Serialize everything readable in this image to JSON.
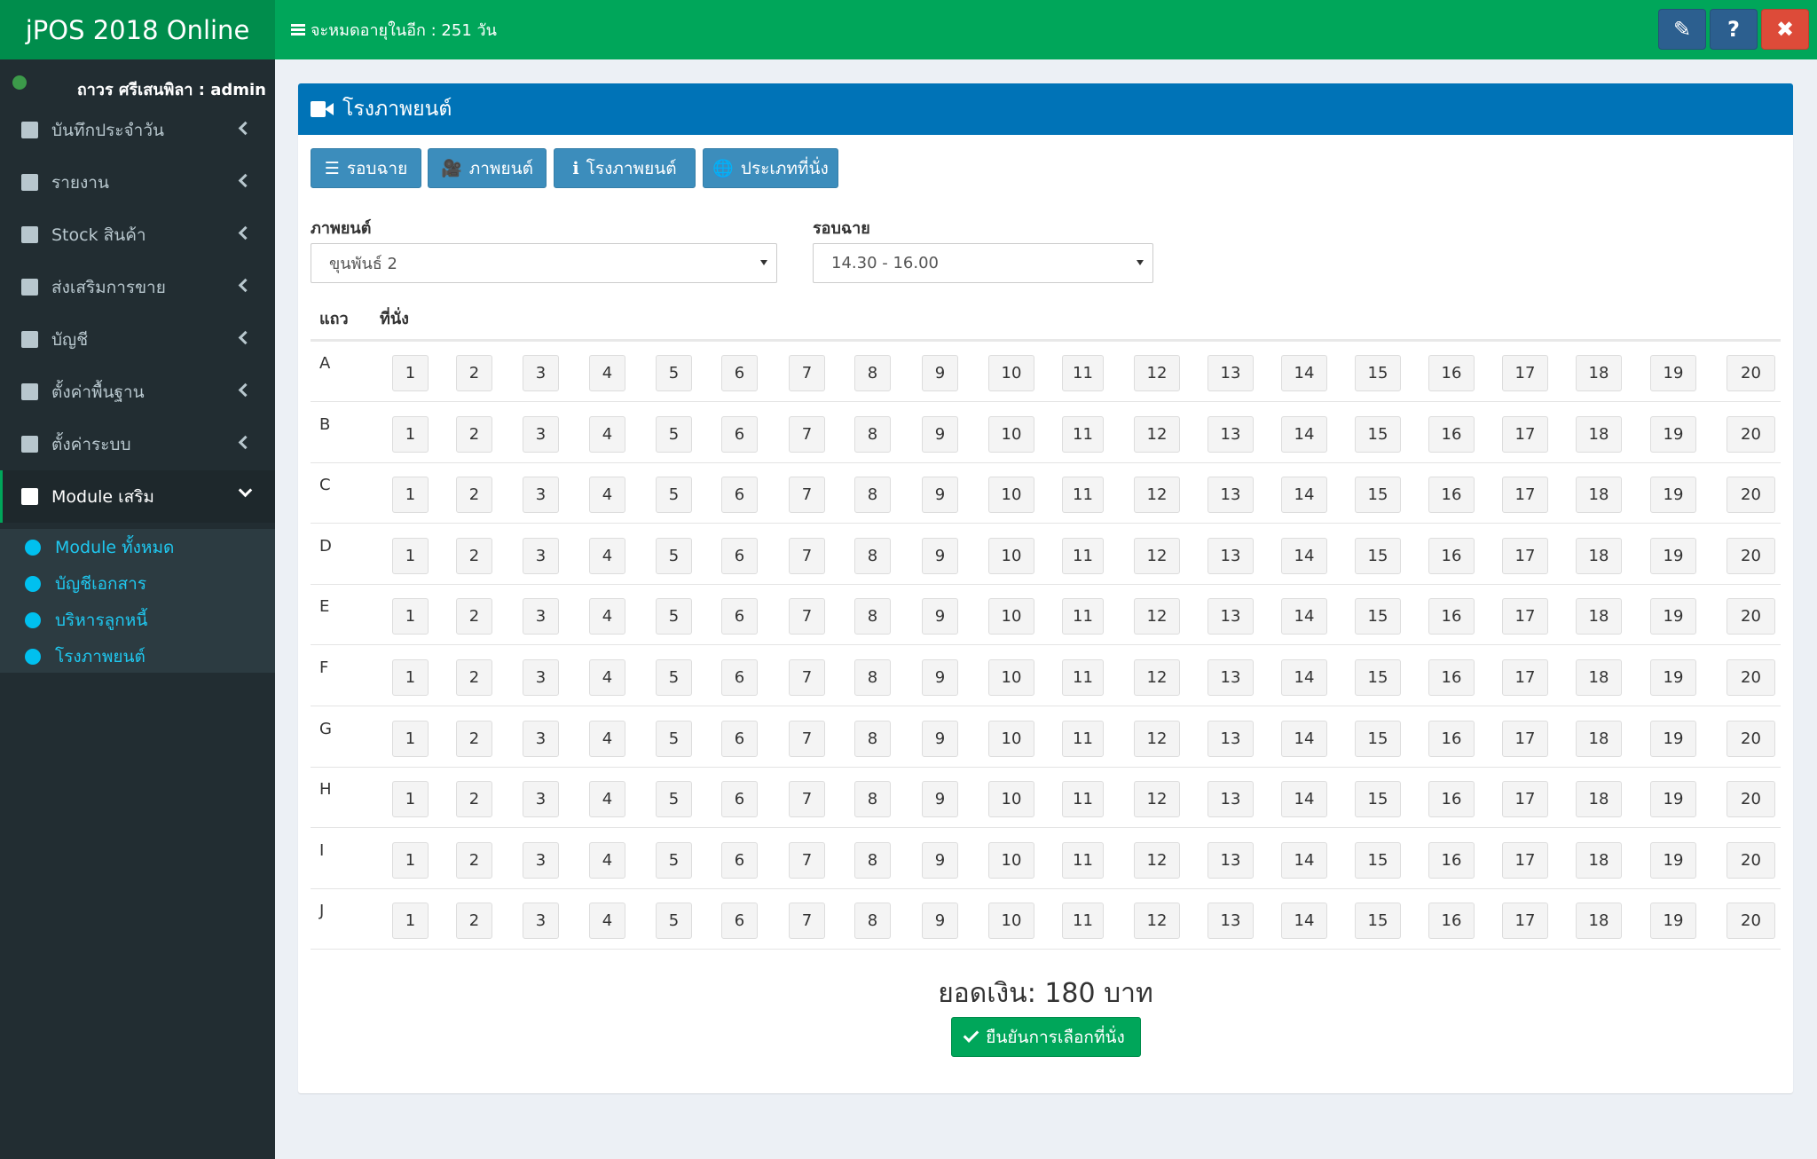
{
  "app": {
    "title": "jPOS 2018 Online",
    "expiry_text": "จะหมดอายุในอีก : 251 วัน"
  },
  "topbar": {
    "edit_label": "✎",
    "help_label": "?",
    "close_label": "✖"
  },
  "user": {
    "name": "ถาวร ศรีเสนพิลา : admin",
    "status_color": "#3c9a4a"
  },
  "sidebar": {
    "items": [
      {
        "label": "บันทึกประจำวัน",
        "icon": "book-icon"
      },
      {
        "label": "รายงาน",
        "icon": "file-icon"
      },
      {
        "label": "Stock สินค้า",
        "icon": "grid-icon"
      },
      {
        "label": "ส่งเสริมการขาย",
        "icon": "gift-icon"
      },
      {
        "label": "บัญชี",
        "icon": "laptop-icon"
      },
      {
        "label": "ตั้งค่าพื้นฐาน",
        "icon": "gear-icon"
      },
      {
        "label": "ตั้งค่าระบบ",
        "icon": "gears-icon"
      },
      {
        "label": "Module เสริม",
        "icon": "plug-icon"
      }
    ],
    "submenu": [
      {
        "label": "Module ทั้งหมด"
      },
      {
        "label": "บัญชีเอกสาร"
      },
      {
        "label": "บริหารลูกหนี้"
      },
      {
        "label": "โรงภาพยนต์"
      }
    ]
  },
  "box": {
    "title": "โรงภาพยนต์"
  },
  "tabs": [
    {
      "label": "รอบฉาย",
      "icon": "☰"
    },
    {
      "label": "ภาพยนต์",
      "icon": "🎥"
    },
    {
      "label": "โรงภาพยนต์",
      "icon": "ℹ"
    },
    {
      "label": "ประเภทที่นั่ง",
      "icon": "🌐"
    }
  ],
  "form": {
    "movie_label": "ภาพยนต์",
    "movie_value": "ขุนพันธ์ 2",
    "showtime_label": "รอบฉาย",
    "showtime_value": "14.30 - 16.00"
  },
  "table": {
    "row_header": "แถว",
    "seat_header": "ที่นั่ง",
    "rows": [
      "A",
      "B",
      "C",
      "D",
      "E",
      "F",
      "G",
      "H",
      "I",
      "J"
    ],
    "seats": [
      "1",
      "2",
      "3",
      "4",
      "5",
      "6",
      "7",
      "8",
      "9",
      "10",
      "11",
      "12",
      "13",
      "14",
      "15",
      "16",
      "17",
      "18",
      "19",
      "20"
    ]
  },
  "footer": {
    "total_text": "ยอดเงิน: 180 บาท",
    "confirm_label": "ยืนยันการเลือกที่นั่ง"
  },
  "colors": {
    "topbar": "#00a65a",
    "logo_bg": "#008d4c",
    "sidebar": "#222d32",
    "header_blue": "#0073b7",
    "button_blue": "#3c8dbc",
    "confirm_green": "#00a65a",
    "close_red": "#dd4b39"
  }
}
